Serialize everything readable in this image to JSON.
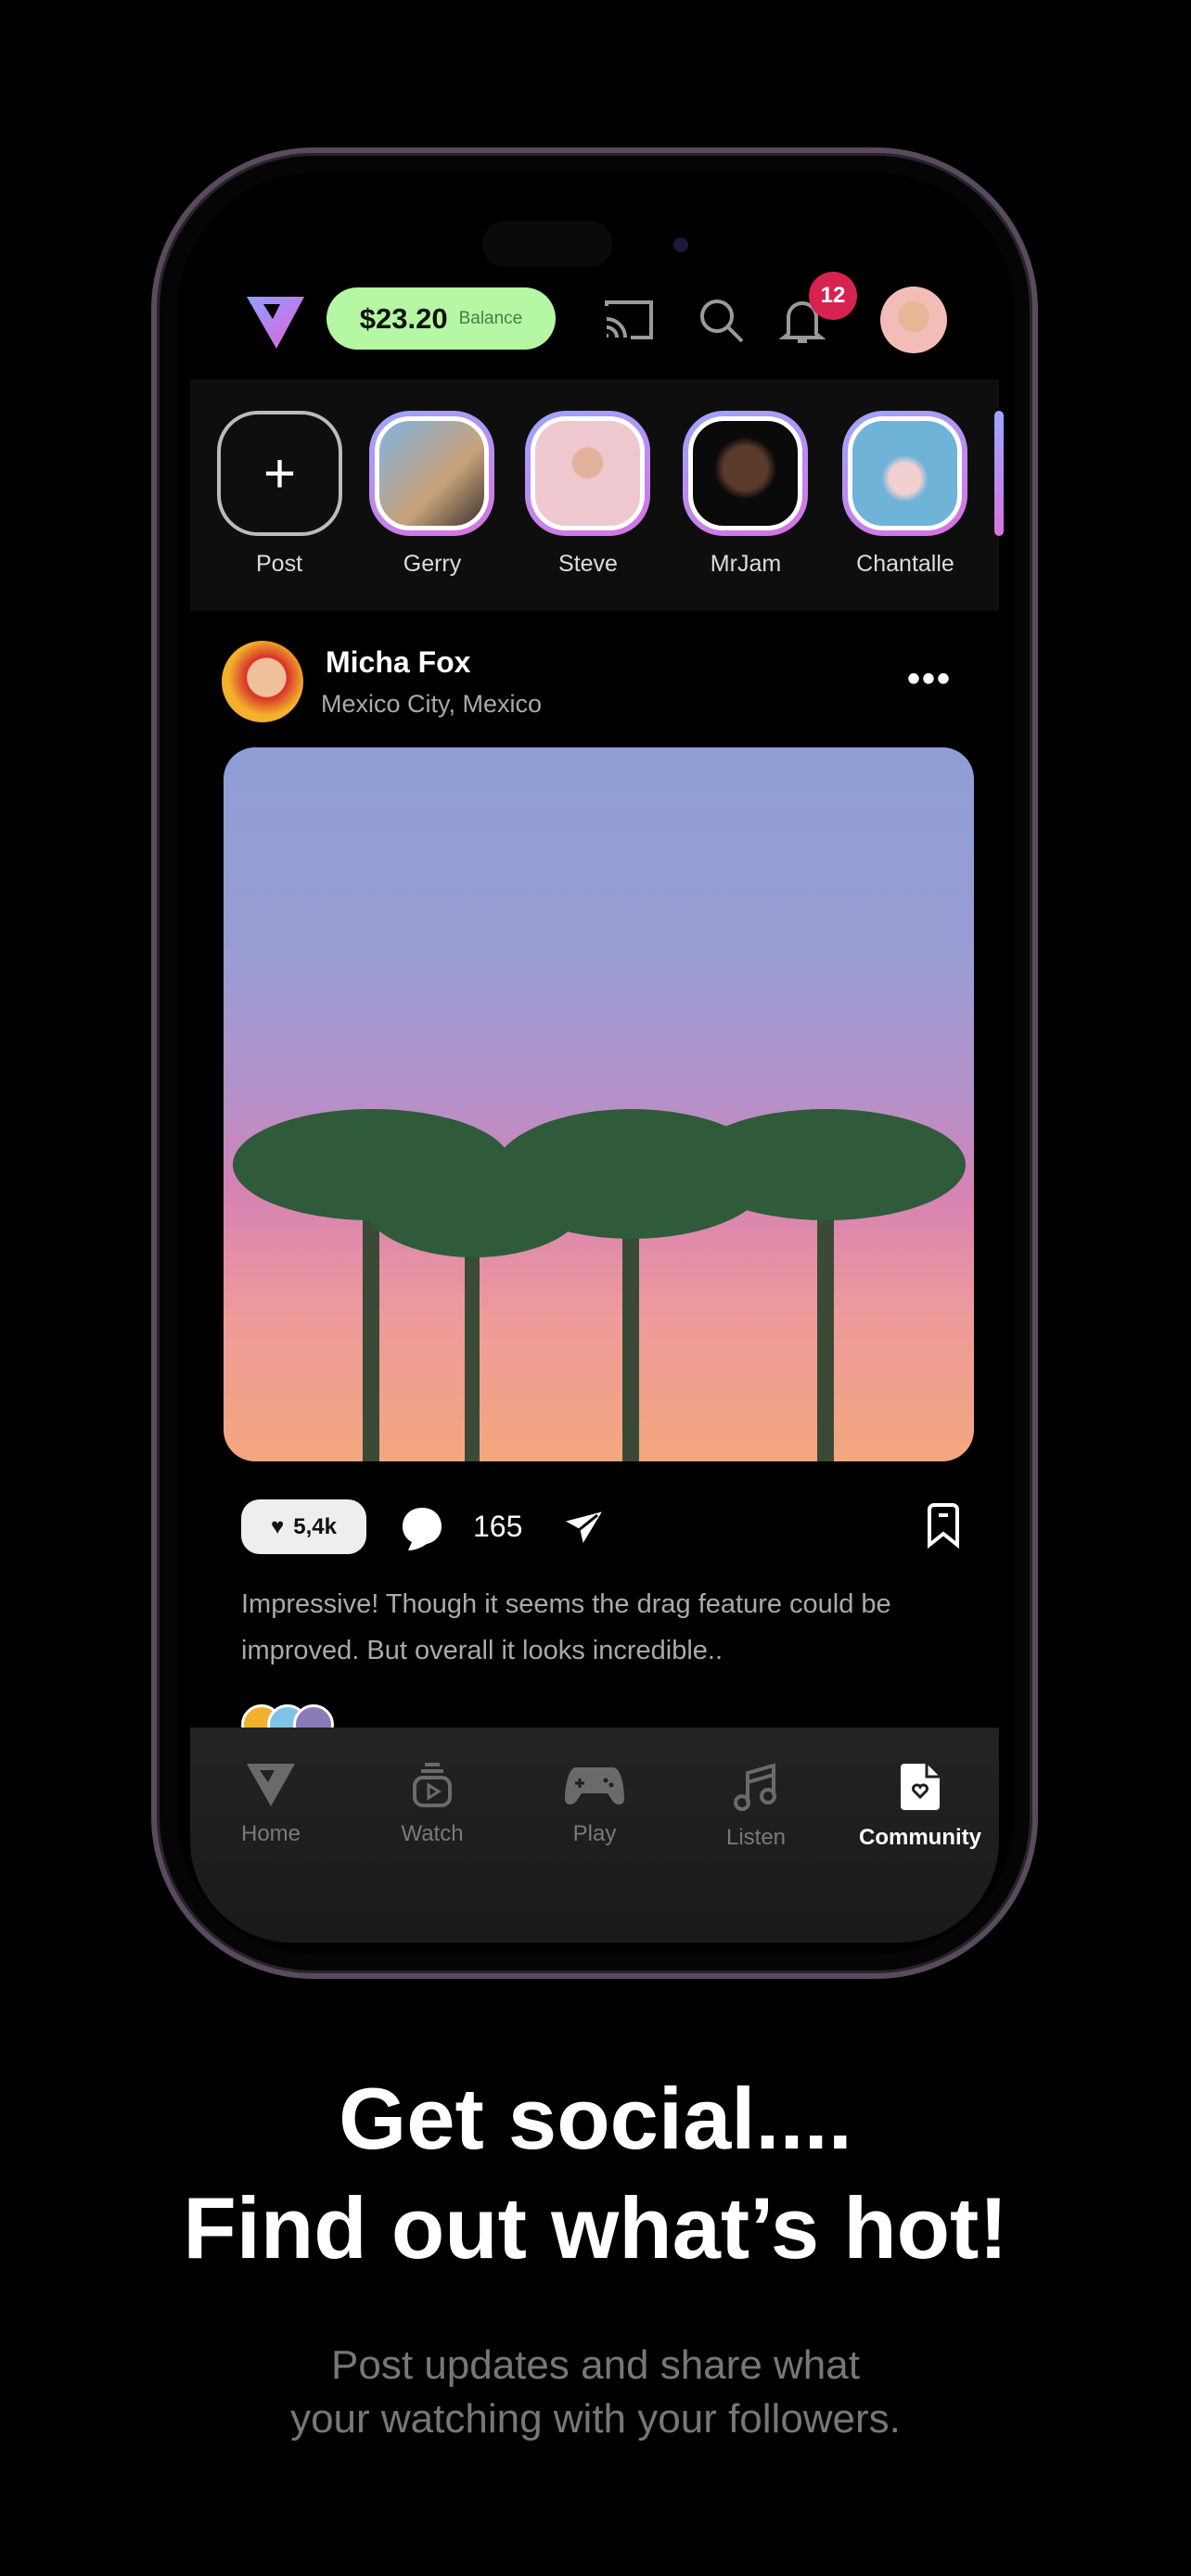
{
  "header": {
    "balance_amount": "$23.20",
    "balance_label": "Balance",
    "notification_count": "12"
  },
  "stories": [
    {
      "label": "Post"
    },
    {
      "label": "Gerry"
    },
    {
      "label": "Steve"
    },
    {
      "label": "MrJam"
    },
    {
      "label": "Chantalle"
    }
  ],
  "post": {
    "author": "Micha Fox",
    "location": "Mexico City, Mexico",
    "likes": "5,4k",
    "comments": "165",
    "caption": "Impressive! Though it seems the drag feature could be improved. But overall it looks incredible.."
  },
  "tabs": [
    {
      "label": "Home"
    },
    {
      "label": "Watch"
    },
    {
      "label": "Play"
    },
    {
      "label": "Listen"
    },
    {
      "label": "Community",
      "active": true
    }
  ],
  "promo": {
    "headline_1": "Get social....",
    "headline_2": "Find out what’s hot!",
    "subtext": "Post updates and share what your watching with your followers."
  },
  "colors": {
    "balance_bg": "#b5f7a3",
    "badge": "#d6224f",
    "story_ring_start": "#9da7ff",
    "story_ring_end": "#d871e0"
  }
}
